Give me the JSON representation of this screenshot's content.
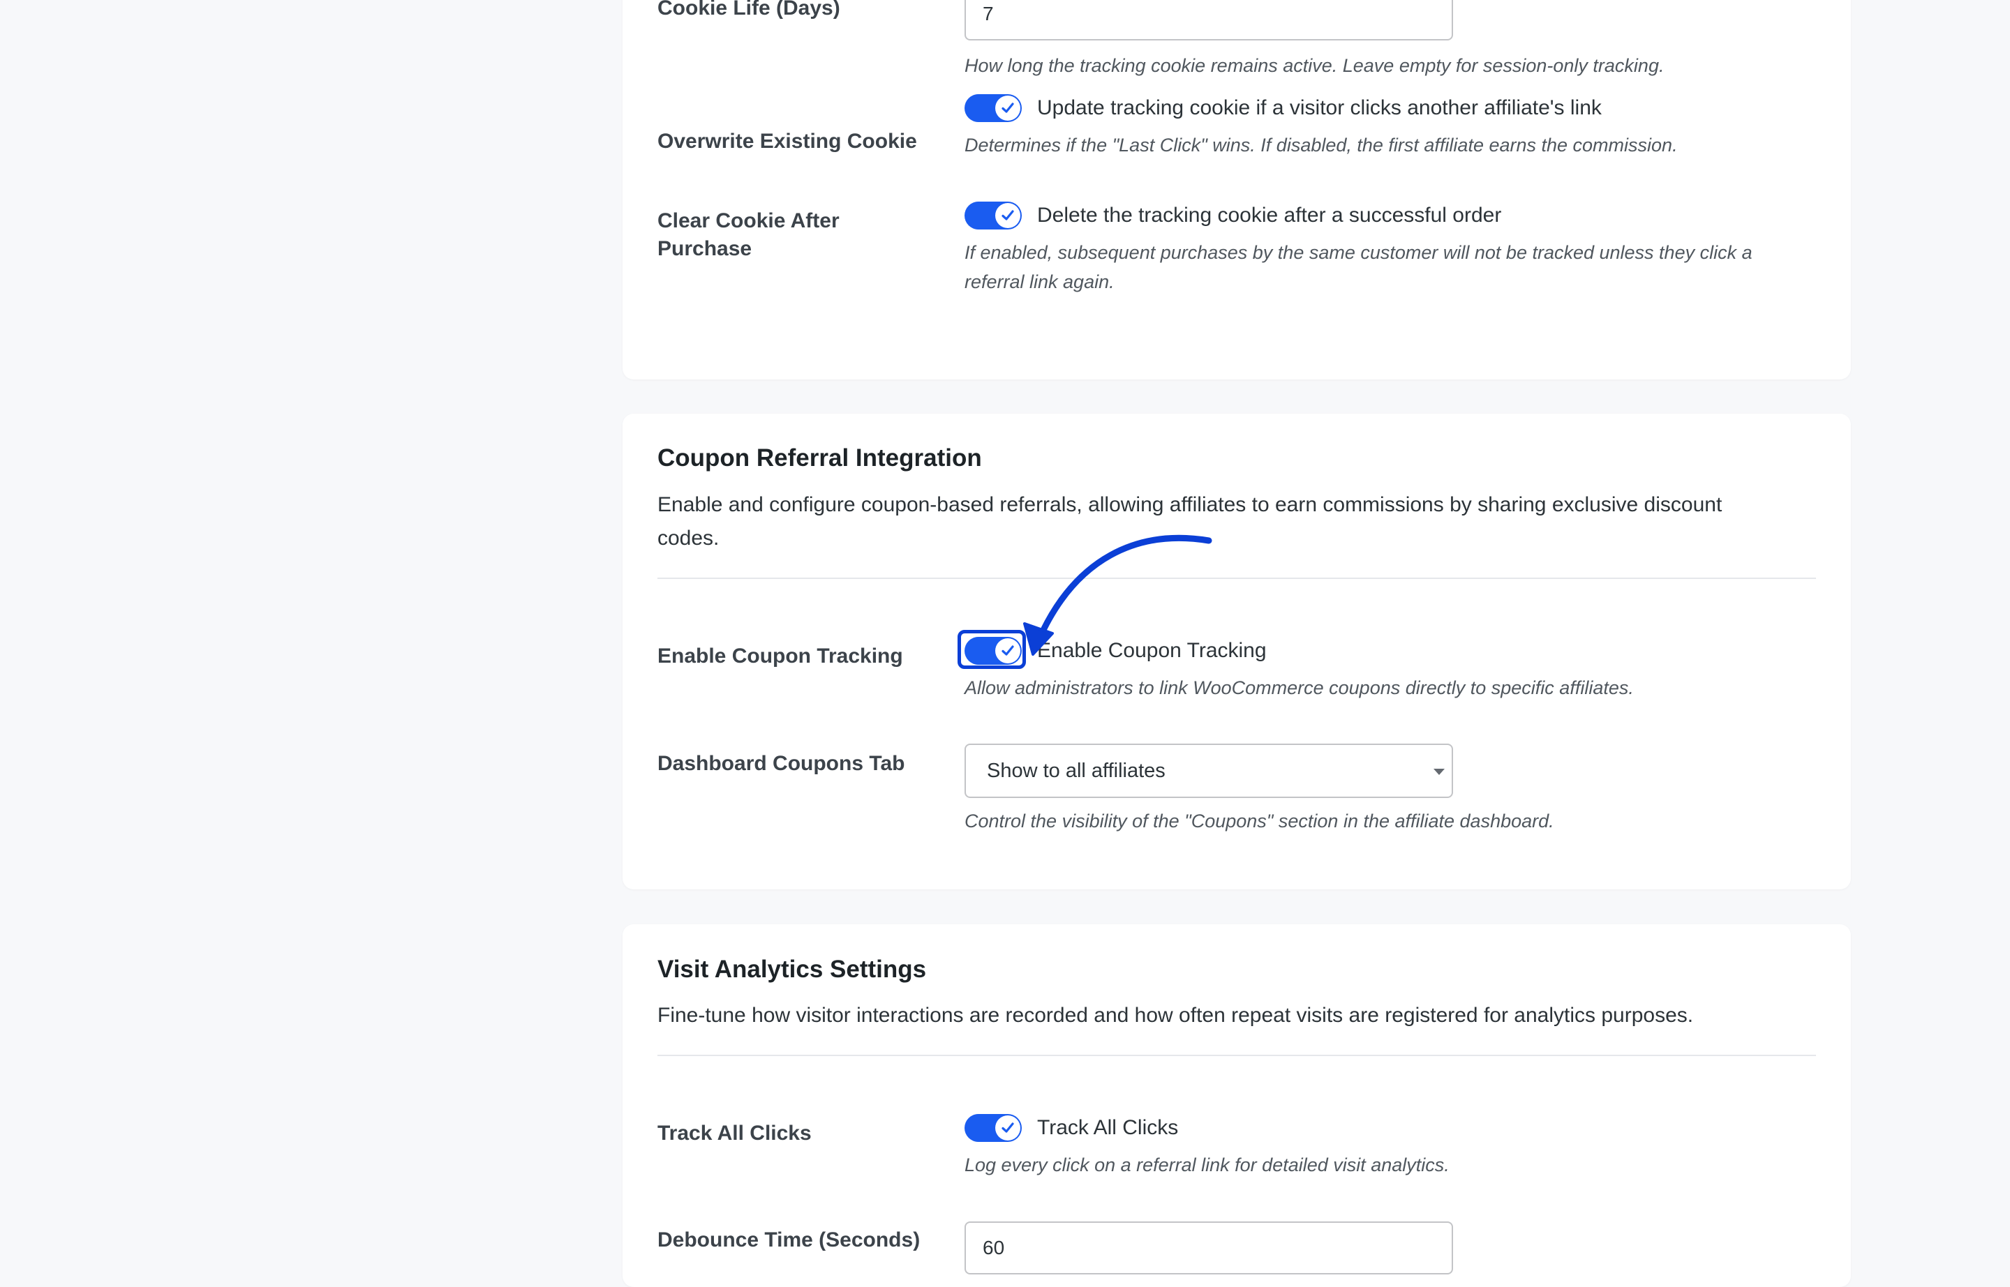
{
  "tracking_card": {
    "cookie_life": {
      "label": "Cookie Life (Days)",
      "value": "7",
      "description": "How long the tracking cookie remains active. Leave empty for session-only tracking."
    },
    "overwrite_cookie": {
      "label": "Overwrite Existing Cookie",
      "toggle_text": "Update tracking cookie if a visitor clicks another affiliate's link",
      "enabled": true,
      "description": "Determines if the \"Last Click\" wins. If disabled, the first affiliate earns the commission."
    },
    "clear_cookie": {
      "label": "Clear Cookie After Purchase",
      "toggle_text": "Delete the tracking cookie after a successful order",
      "enabled": true,
      "description": "If enabled, subsequent purchases by the same customer will not be tracked unless they click a referral link again."
    }
  },
  "coupon_card": {
    "title": "Coupon Referral Integration",
    "intro": "Enable and configure coupon-based referrals, allowing affiliates to earn commissions by sharing exclusive discount codes.",
    "enable_tracking": {
      "label": "Enable Coupon Tracking",
      "toggle_text": "Enable Coupon Tracking",
      "enabled": true,
      "description": "Allow administrators to link WooCommerce coupons directly to specific affiliates."
    },
    "dashboard_tab": {
      "label": "Dashboard Coupons Tab",
      "selected": "Show to all affiliates",
      "description": "Control the visibility of the \"Coupons\" section in the affiliate dashboard."
    }
  },
  "analytics_card": {
    "title": "Visit Analytics Settings",
    "intro": "Fine-tune how visitor interactions are recorded and how often repeat visits are registered for analytics purposes.",
    "track_clicks": {
      "label": "Track All Clicks",
      "toggle_text": "Track All Clicks",
      "enabled": true,
      "description": "Log every click on a referral link for detailed visit analytics."
    },
    "debounce": {
      "label": "Debounce Time (Seconds)",
      "value": "60"
    }
  },
  "colors": {
    "toggle_on": "#1a5cf0",
    "annotation_arrow": "#0b3fd6",
    "page_bg": "#f7f8fa",
    "card_bg": "#ffffff"
  },
  "icons": {
    "toggle_check": "checkmark-icon",
    "select_caret": "caret-down-icon",
    "annotation": "arrow-annotation-icon"
  }
}
